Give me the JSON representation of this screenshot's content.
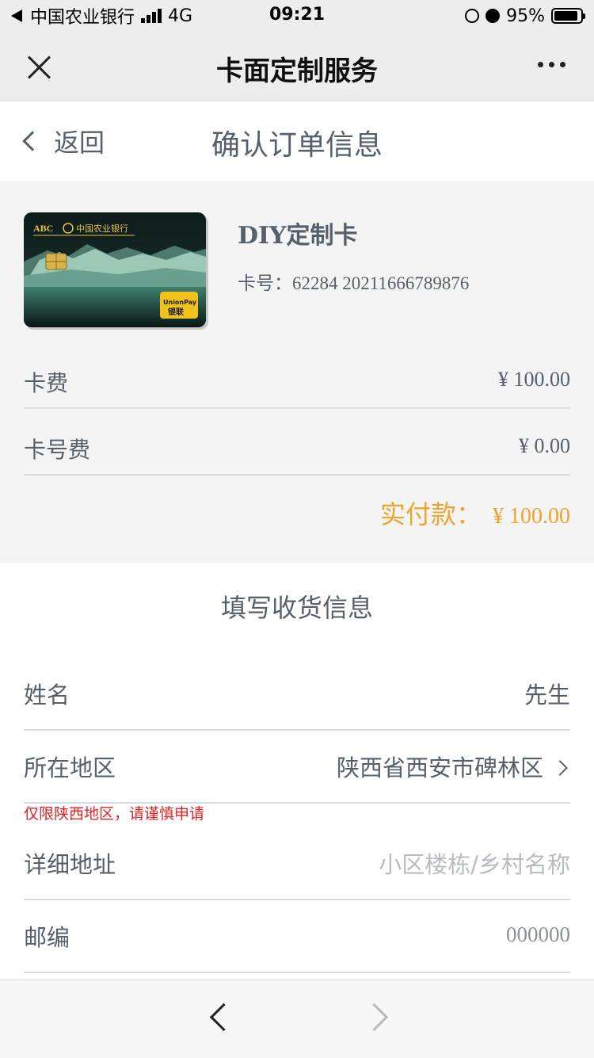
{
  "status_bar": {
    "carrier": "中国农业银行",
    "network": "4G",
    "time": "09:21",
    "battery": "95%"
  },
  "wechat_nav": {
    "title": "卡面定制服务"
  },
  "header": {
    "back_label": "返回",
    "title": "确认订单信息"
  },
  "card": {
    "bank_name": "中国农业银行",
    "bank_abbr": "ABC",
    "union_pay_label": "UnionPay",
    "union_pay_cn": "银联",
    "name": "DIY定制卡",
    "number_text": "卡号：62284 20211666789876"
  },
  "fees": [
    {
      "label": "卡费",
      "value": "¥ 100.00"
    },
    {
      "label": "卡号费",
      "value": "¥ 0.00"
    }
  ],
  "total": {
    "label": "实付款：",
    "value": "¥ 100.00"
  },
  "delivery": {
    "title": "填写收货信息",
    "name_label": "姓名",
    "name_value": "先生",
    "region_label": "所在地区",
    "region_value": "陕西省西安市碑林区",
    "notice": "仅限陕西地区，请谨慎申请",
    "address_label": "详细地址",
    "address_placeholder": "小区楼栋/乡村名称",
    "zip_label": "邮编",
    "zip_placeholder": "000000"
  },
  "colors": {
    "accent": "#f0a52a",
    "label": "#56606b",
    "notice": "#e02222"
  }
}
